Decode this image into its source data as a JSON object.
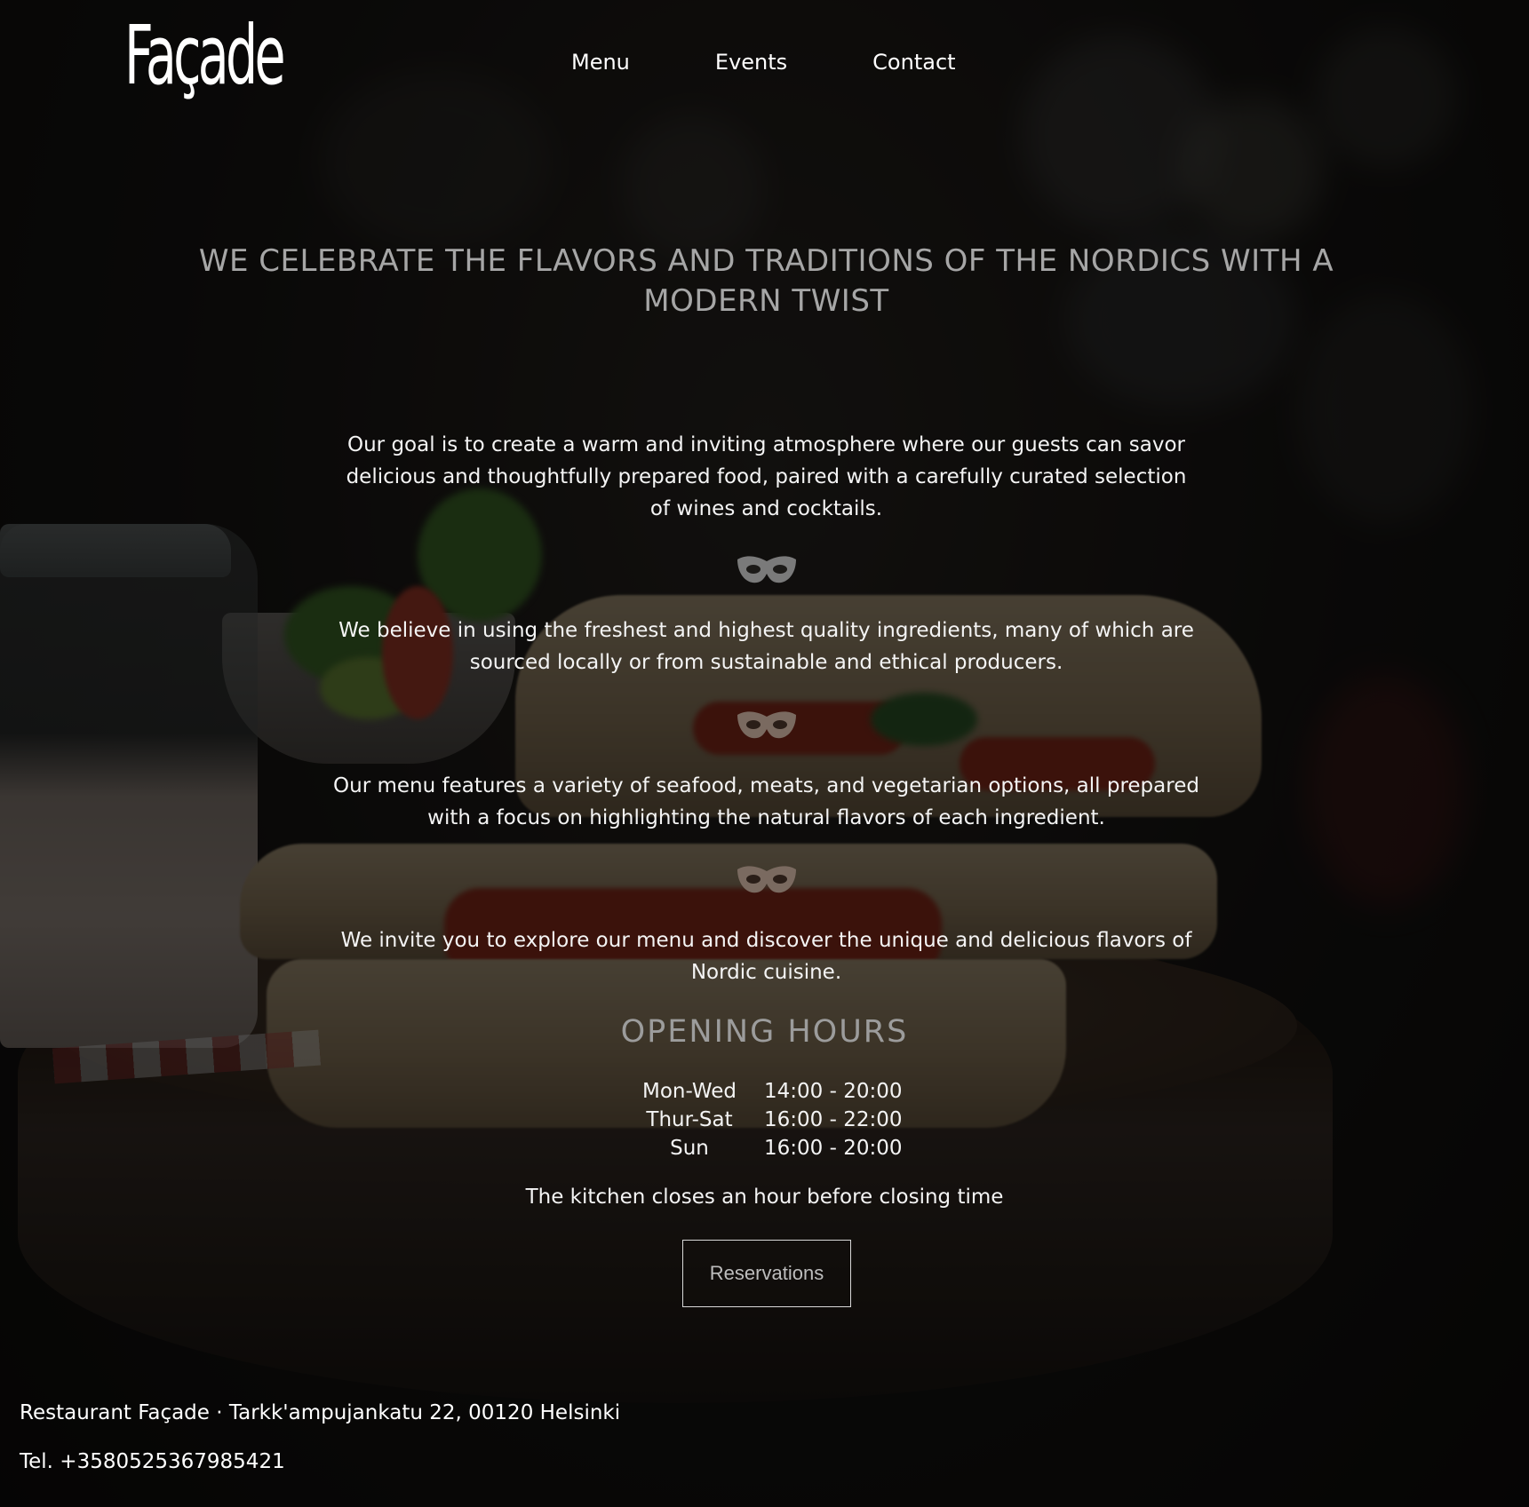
{
  "header": {
    "logo": "Façade",
    "nav": [
      "Menu",
      "Events",
      "Contact"
    ]
  },
  "hero": {
    "headline": "WE CELEBRATE THE FLAVORS AND TRADITIONS OF THE NORDICS WITH A MODERN TWIST"
  },
  "intro": {
    "paragraphs": [
      "Our goal is to create a warm and inviting atmosphere where our guests can savor delicious and thoughtfully prepared food, paired with a carefully curated selection of wines and cocktails.",
      "We believe in using the freshest and highest quality ingredients, many of which are sourced locally or from sustainable and ethical producers.",
      "Our menu features a variety of seafood, meats, and vegetarian options, all prepared with a focus on highlighting the natural flavors of each ingredient.",
      "We invite you to explore our menu and discover the unique and delicious flavors of Nordic cuisine."
    ],
    "divider_icon": "mask-icon"
  },
  "hours": {
    "title": "OPENING HOURS",
    "rows": [
      {
        "day": "Mon-Wed",
        "time": "14:00 - 20:00"
      },
      {
        "day": "Thur-Sat",
        "time": "16:00 - 22:00"
      },
      {
        "day": "Sun",
        "time": "16:00 - 20:00"
      }
    ],
    "note": "The kitchen closes an hour before closing time",
    "button_label": "Reservations"
  },
  "footer": {
    "address": "Restaurant Façade · Tarkk'ampujankatu 22, 00120 Helsinki",
    "phone": "Tel. +3580525367985421"
  },
  "colors": {
    "overlay": "#000000",
    "headline": "#a6a6a6",
    "text": "#f4f4f4"
  }
}
